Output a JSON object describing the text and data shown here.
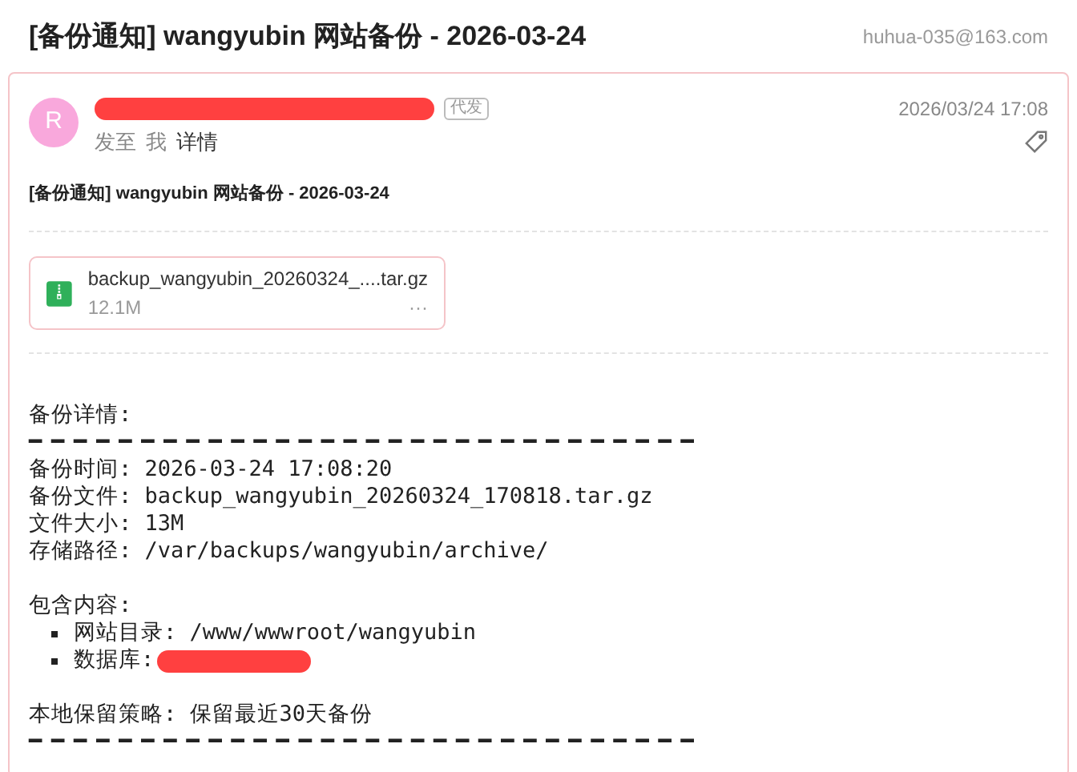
{
  "header": {
    "title": "[备份通知] wangyubin 网站备份 - 2026-03-24",
    "account": "huhua-035@163.com"
  },
  "message": {
    "avatar": "R",
    "sender_redacted": true,
    "badge": "代发",
    "sent_to_label": "发至",
    "recipient": "我",
    "details_link": "详情",
    "time": "2026/03/24 17:08",
    "subject": "[备份通知] wangyubin 网站备份 - 2026-03-24"
  },
  "attachment": {
    "name": "backup_wangyubin_20260324_....tar.gz",
    "size": "12.1M",
    "more": "···"
  },
  "body": [
    {
      "kind": "text",
      "text": "备份详情:"
    },
    {
      "kind": "rule",
      "text": "━━━━━━━━━━━━━━━━━━━━━━━━━━━━━━"
    },
    {
      "kind": "text",
      "text": "备份时间: 2026-03-24 17:08:20"
    },
    {
      "kind": "text",
      "text": "备份文件: backup_wangyubin_20260324_170818.tar.gz"
    },
    {
      "kind": "text",
      "text": "文件大小: 13M"
    },
    {
      "kind": "text",
      "text": "存储路径: /var/backups/wangyubin/archive/"
    },
    {
      "kind": "blank"
    },
    {
      "kind": "text",
      "text": "包含内容:"
    },
    {
      "kind": "bullet",
      "text": "网站目录: /www/wwwroot/wangyubin"
    },
    {
      "kind": "bullet",
      "text": "数据库:",
      "redacted": true
    },
    {
      "kind": "blank"
    },
    {
      "kind": "text",
      "text": "本地保留策略: 保留最近30天备份"
    },
    {
      "kind": "rule",
      "text": "━━━━━━━━━━━━━━━━━━━━━━━━━━━━━━"
    }
  ]
}
